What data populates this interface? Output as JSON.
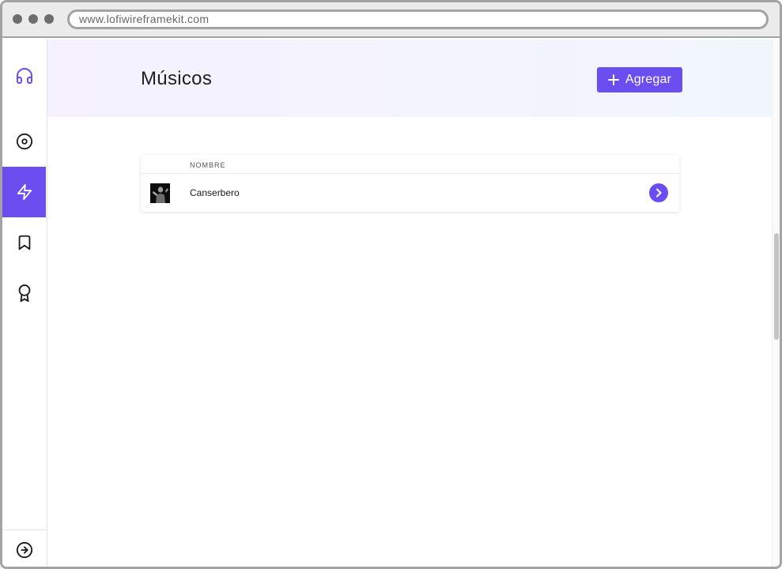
{
  "browser": {
    "url": "www.lofiwireframekit.com"
  },
  "sidebar": {
    "logo_icon": "headphones-icon",
    "items": [
      {
        "icon": "disc-icon",
        "active": false
      },
      {
        "icon": "lightning-icon",
        "active": true
      },
      {
        "icon": "bookmark-icon",
        "active": false
      },
      {
        "icon": "award-icon",
        "active": false
      }
    ],
    "footer_icon": "arrow-right-circle-icon"
  },
  "header": {
    "title": "Músicos",
    "add_label": "Agregar"
  },
  "table": {
    "columns": [
      "NOMBRE"
    ],
    "rows": [
      {
        "name": "Canserbero"
      }
    ]
  },
  "colors": {
    "accent": "#6a4ef0",
    "header_bg": "#f4f2fe"
  }
}
